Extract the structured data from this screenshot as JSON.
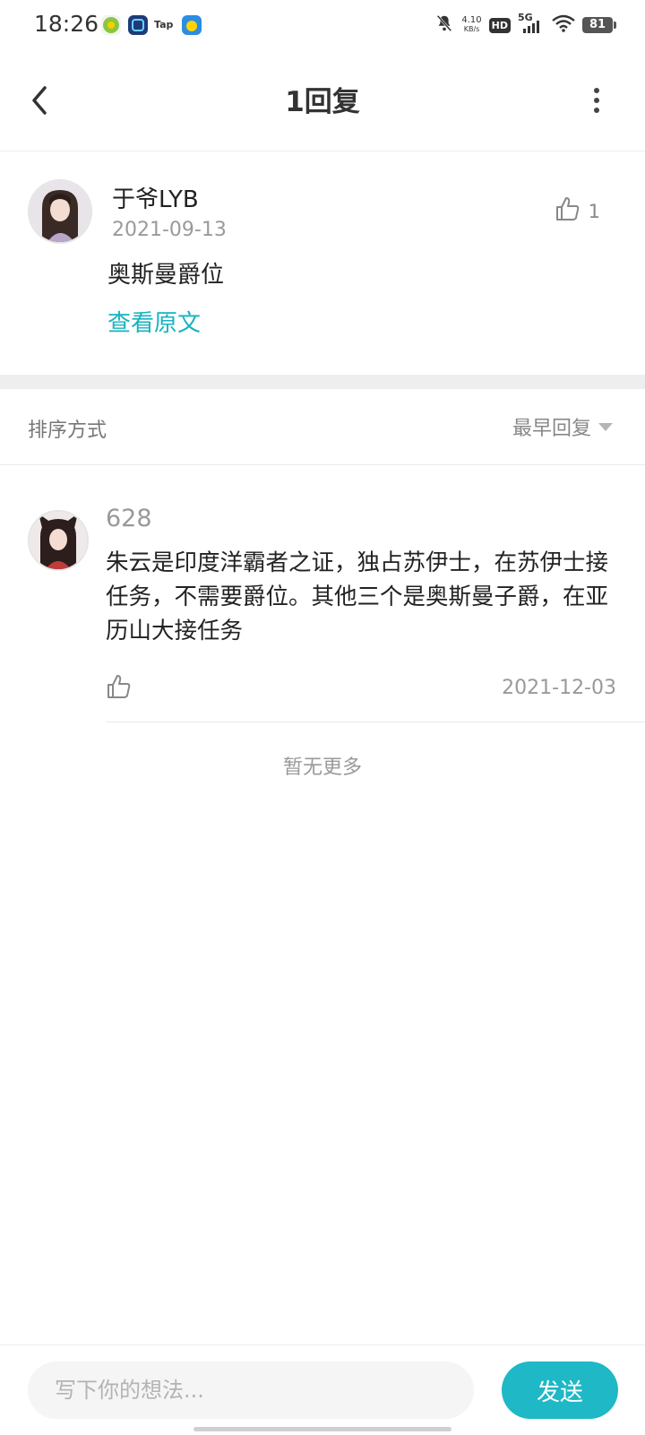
{
  "status_bar": {
    "time": "18:26",
    "net_speed_value": "4.10",
    "net_speed_unit": "KB/s",
    "hd": "HD",
    "signal": "5G",
    "battery": "81",
    "app_icons": [
      "green-app-icon",
      "blue-app-icon",
      "tap-app-icon",
      "yellow-app-icon"
    ],
    "tap_label": "Tap"
  },
  "header": {
    "title": "1回复",
    "back_icon": "chevron-left-icon",
    "more_icon": "more-vertical-icon"
  },
  "post": {
    "username": "于爷LYB",
    "date": "2021-09-13",
    "content": "奥斯曼爵位",
    "like_count": "1",
    "view_original_label": "查看原文"
  },
  "sort": {
    "label": "排序方式",
    "selected": "最早回复"
  },
  "replies": [
    {
      "username": "628",
      "content": "朱云是印度洋霸者之证，独占苏伊士，在苏伊士接任务，不需要爵位。其他三个是奥斯曼子爵，在亚历山大接任务",
      "date": "2021-12-03"
    }
  ],
  "no_more_label": "暂无更多",
  "composer": {
    "placeholder": "写下你的想法...",
    "send_label": "发送"
  },
  "colors": {
    "accent": "#1eb8c6",
    "link": "#16b3c1",
    "divider": "#eeeeee"
  }
}
